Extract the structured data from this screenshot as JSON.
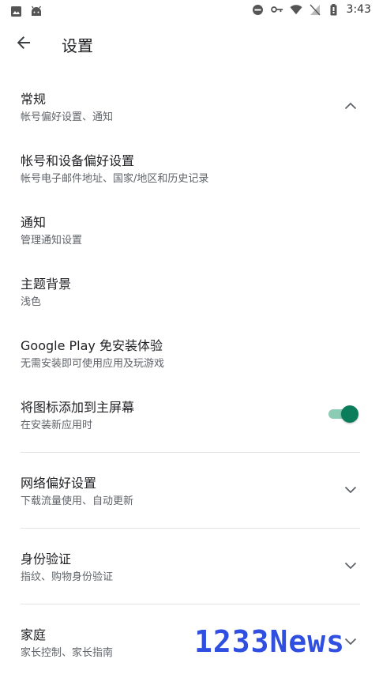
{
  "status_bar": {
    "time": "3:43",
    "left_icons": [
      "image-icon",
      "android-icon"
    ],
    "right_icons": [
      "do-not-disturb-icon",
      "vpn-key-icon",
      "wifi-icon",
      "no-sim-icon",
      "battery-icon"
    ]
  },
  "app_bar": {
    "title": "设置",
    "back_icon": "arrow-left-icon"
  },
  "settings": {
    "general": {
      "title": "常规",
      "subtitle": "帐号偏好设置、通知",
      "chevron": "chevron-up-icon"
    },
    "account": {
      "title": "帐号和设备偏好设置",
      "subtitle": "帐号电子邮件地址、国家/地区和历史记录"
    },
    "notifications": {
      "title": "通知",
      "subtitle": "管理通知设置"
    },
    "theme": {
      "title": "主题背景",
      "subtitle": "浅色"
    },
    "instant": {
      "title": "Google Play 免安装体验",
      "subtitle": "无需安装即可使用应用及玩游戏"
    },
    "home_icon": {
      "title": "将图标添加到主屏幕",
      "subtitle": "在安装新应用时",
      "toggle_on": true
    },
    "network": {
      "title": "网络偏好设置",
      "subtitle": "下载流量使用、自动更新",
      "chevron": "chevron-down-icon"
    },
    "auth": {
      "title": "身份验证",
      "subtitle": "指纹、购物身份验证",
      "chevron": "chevron-down-icon"
    },
    "family": {
      "title": "家庭",
      "subtitle": "家长控制、家长指南",
      "chevron": "chevron-down-icon"
    }
  },
  "watermark": {
    "text": "1233News"
  },
  "colors": {
    "accent": "#0b7d5a",
    "toggle_track": "#8ccbb4",
    "watermark": "#2f4fe0",
    "divider": "#e3e3e3"
  }
}
